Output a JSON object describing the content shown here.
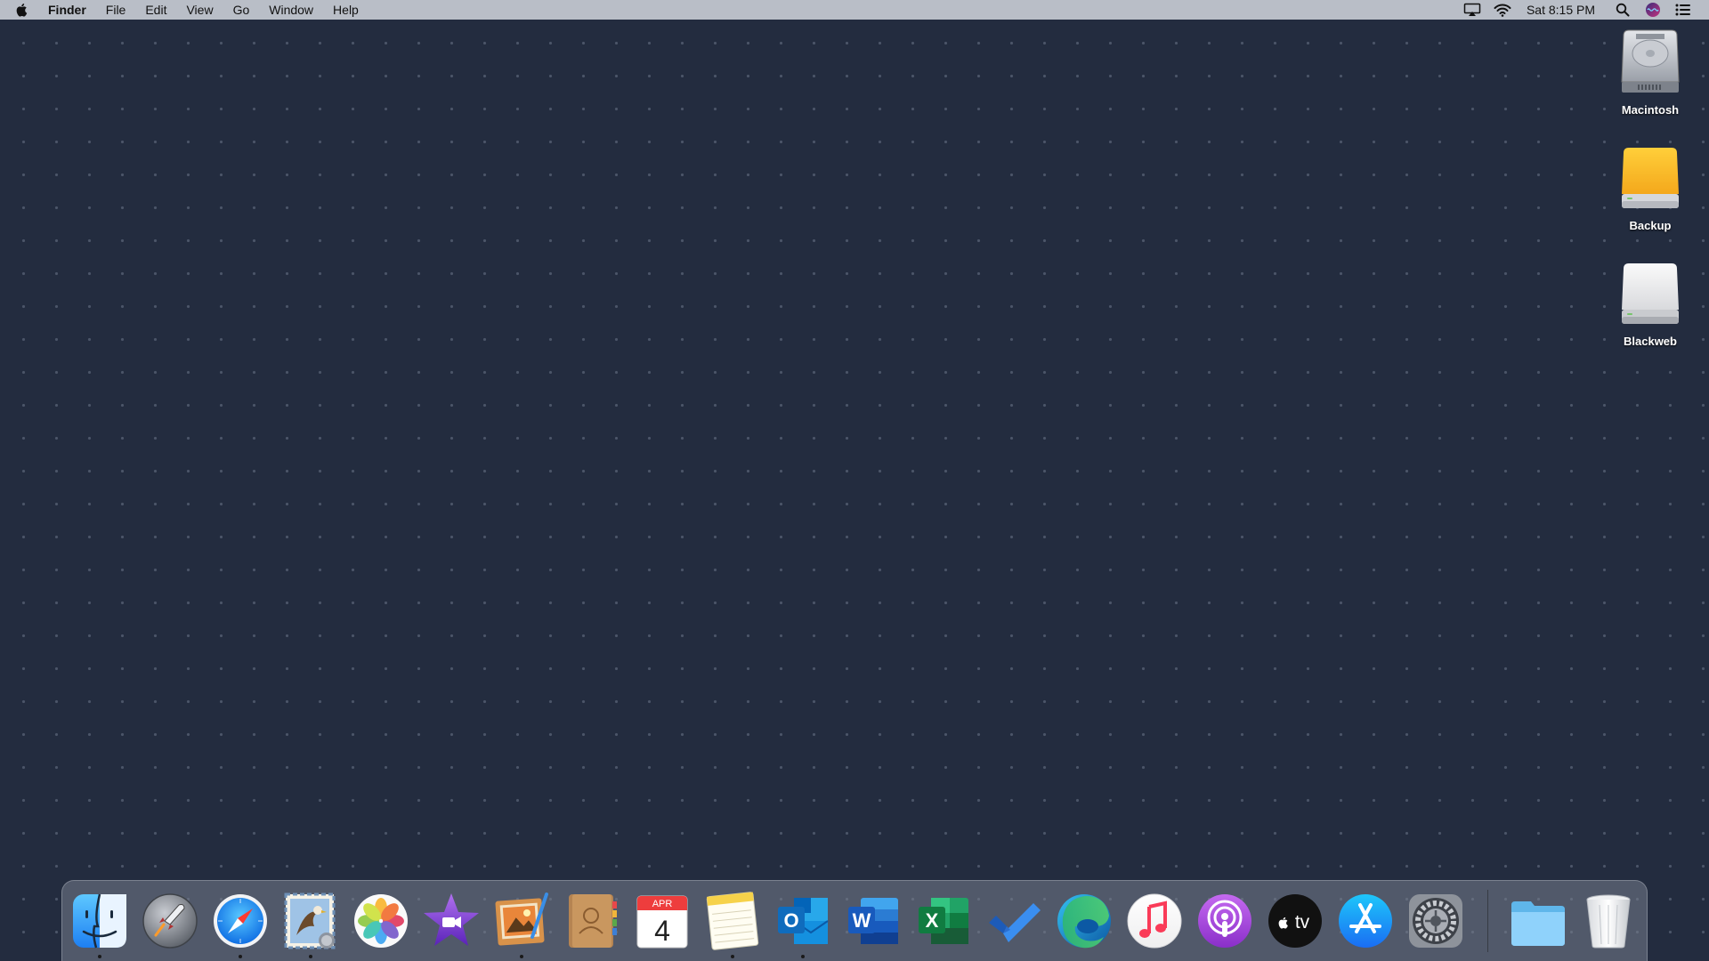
{
  "menubar": {
    "app_name": "Finder",
    "items": [
      "File",
      "Edit",
      "View",
      "Go",
      "Window",
      "Help"
    ],
    "status_icons": [
      "airplay-icon",
      "wifi-icon"
    ],
    "clock": "Sat 8:15 PM",
    "right_icons": [
      "spotlight-icon",
      "siri-icon",
      "notification-center-icon"
    ]
  },
  "desktop": {
    "icons": [
      {
        "label": "Macintosh",
        "icon": "hard-drive-icon"
      },
      {
        "label": "Backup",
        "icon": "external-drive-orange-icon"
      },
      {
        "label": "Blackweb",
        "icon": "external-drive-white-icon"
      }
    ]
  },
  "dock": {
    "apps": [
      {
        "name": "finder",
        "running": true
      },
      {
        "name": "launchpad",
        "running": false
      },
      {
        "name": "safari",
        "running": true
      },
      {
        "name": "mail",
        "running": true
      },
      {
        "name": "photos",
        "running": false
      },
      {
        "name": "imovie",
        "running": false
      },
      {
        "name": "preview",
        "running": true
      },
      {
        "name": "contacts",
        "running": false
      },
      {
        "name": "calendar",
        "running": false
      },
      {
        "name": "notes",
        "running": true
      },
      {
        "name": "outlook",
        "running": true
      },
      {
        "name": "word",
        "running": false
      },
      {
        "name": "excel",
        "running": false
      },
      {
        "name": "todo",
        "running": false
      },
      {
        "name": "edge",
        "running": false
      },
      {
        "name": "music",
        "running": false
      },
      {
        "name": "podcasts",
        "running": false
      },
      {
        "name": "apple-tv",
        "running": false
      },
      {
        "name": "app-store",
        "running": false
      },
      {
        "name": "system-preferences",
        "running": false
      }
    ],
    "extras": [
      {
        "name": "folder-stack"
      },
      {
        "name": "trash"
      }
    ],
    "calendar": {
      "month": "APR",
      "day": "4"
    },
    "letters": {
      "outlook": "O",
      "word": "W",
      "excel": "X",
      "tv": "tv"
    }
  },
  "colors": {
    "desktop": "#232c3f",
    "menubar": "#b9bec7",
    "word": "#185abd",
    "excel": "#107c41",
    "outlook": "#0078d4",
    "podcasts": "#9b4fd3"
  }
}
